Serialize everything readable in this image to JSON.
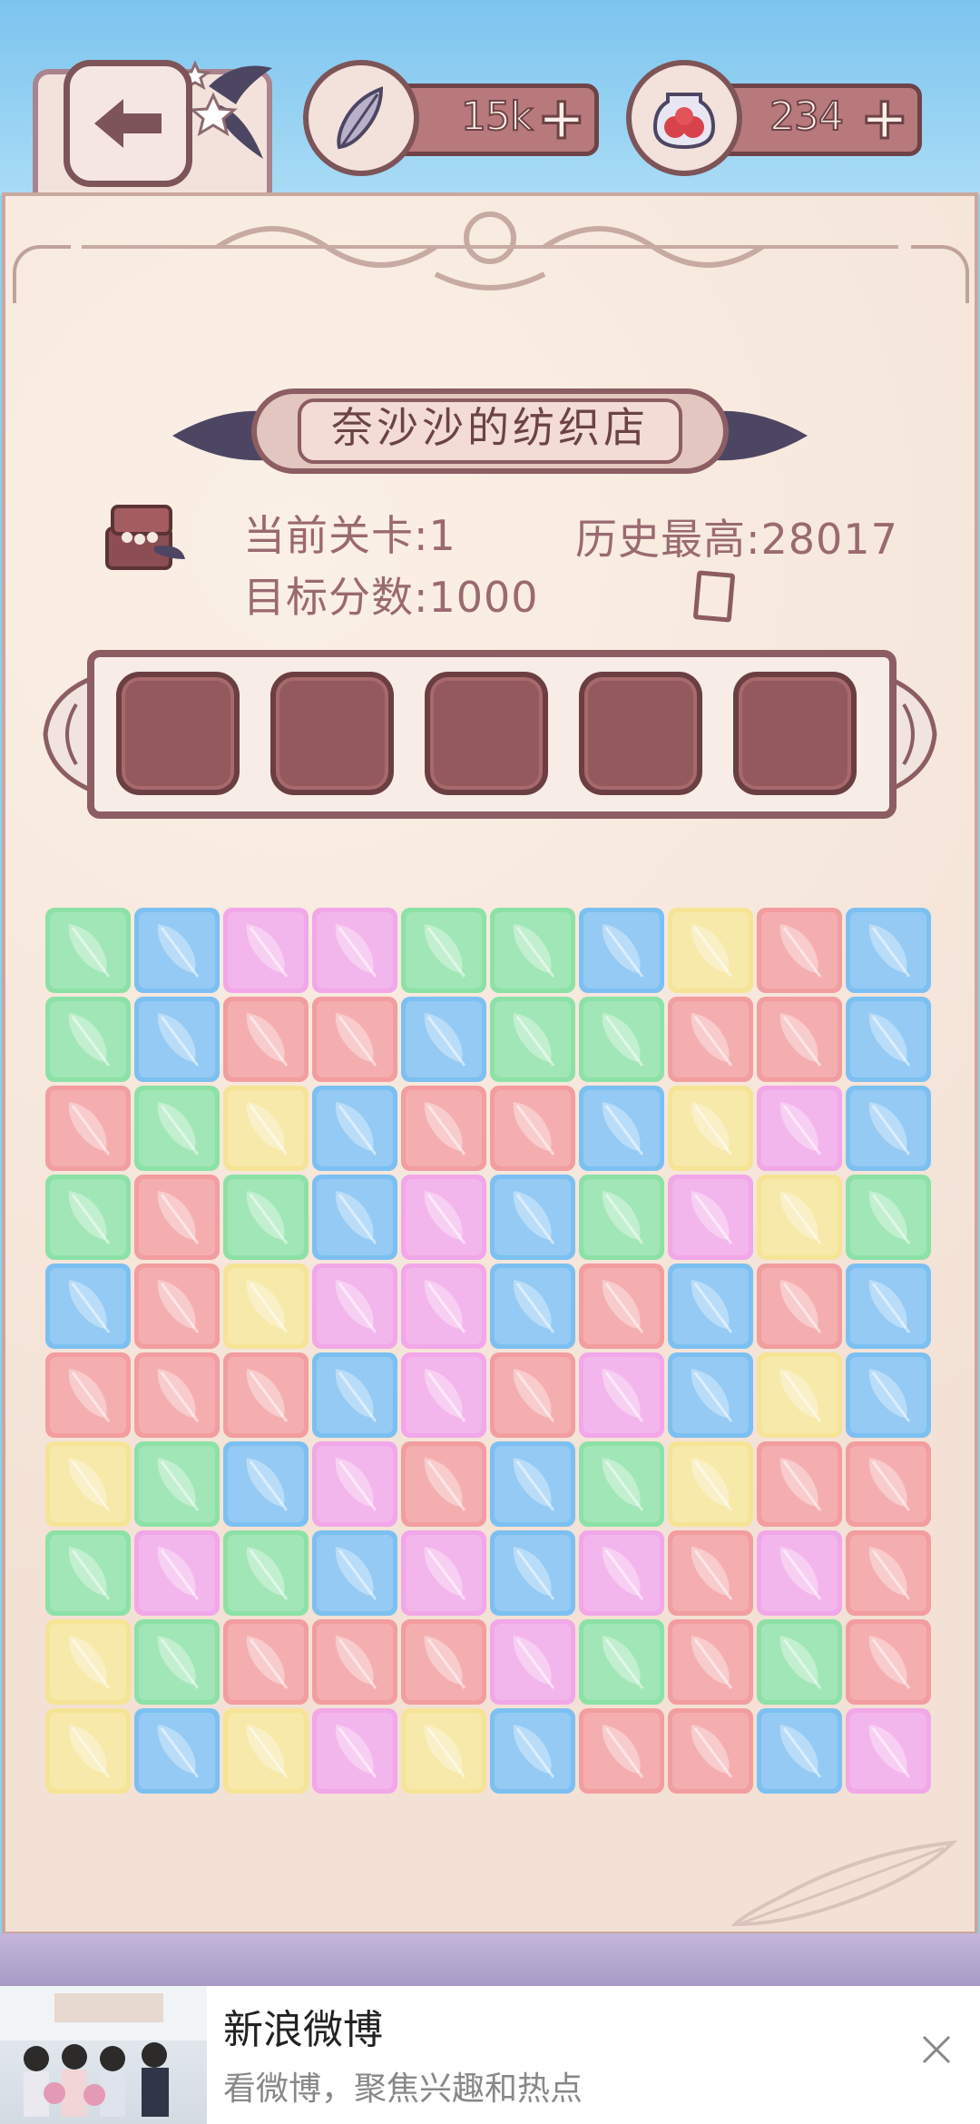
{
  "header": {
    "back_icon": "arrow-left-icon",
    "currency1": {
      "icon": "feather-icon",
      "value": "15k",
      "plus": "+"
    },
    "currency2": {
      "icon": "jar-icon",
      "value": "234",
      "plus": "+"
    }
  },
  "panel": {
    "title": "奈沙沙的纺织店",
    "current_level_label": "当前关卡:",
    "current_level": "1",
    "high_score_label": "历史最高:",
    "high_score": "28017",
    "target_label": "目标分数:",
    "target_score": "1000"
  },
  "slots": {
    "count": 5,
    "filled": 0
  },
  "colors": {
    "g": "#8fe0a8",
    "b": "#7fbfee",
    "p": "#eea8e6",
    "r": "#ef9ea0",
    "y": "#f5e49a"
  },
  "board": {
    "rows": [
      "gbppggbyrb",
      "gbrrbggrrb",
      "rgybrrbypb",
      "grgbpbgpyg",
      "bryppbrbrb",
      "rrrbprpbyb",
      "ygbprbgyrr",
      "gpgbpbprpr",
      "ygrrrpgrgr",
      "ybypybrrbp"
    ]
  },
  "ad": {
    "title": "新浪微博",
    "subtitle": "看微博，聚焦兴趣和热点",
    "close_icon": "close-icon"
  }
}
